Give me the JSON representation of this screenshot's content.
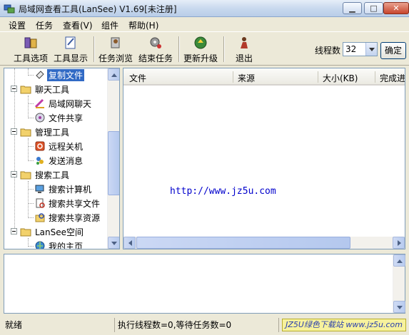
{
  "window": {
    "title": "局域网查看工具(LanSee) V1.69[未注册]"
  },
  "menu": [
    "设置",
    "任务",
    "查看(V)",
    "组件",
    "帮助(H)"
  ],
  "toolbar": {
    "buttons": [
      {
        "label": "工具选项",
        "icon": "options-icon"
      },
      {
        "label": "工具显示",
        "icon": "tool-display-icon"
      },
      {
        "label": "任务浏览",
        "icon": "task-browse-icon"
      },
      {
        "label": "结束任务",
        "icon": "end-task-icon"
      },
      {
        "label": "更新升级",
        "icon": "update-icon"
      },
      {
        "label": "退出",
        "icon": "exit-icon"
      }
    ],
    "thread_label": "线程数",
    "thread_value": "32",
    "ok_label": "确定"
  },
  "tree": [
    {
      "label": "复制文件",
      "icon": "copy-file-icon",
      "selected": true
    },
    {
      "label": "聊天工具",
      "icon": "folder-icon",
      "group": true
    },
    {
      "label": "局域网聊天",
      "icon": "chat-icon"
    },
    {
      "label": "文件共享",
      "icon": "share-icon"
    },
    {
      "label": "管理工具",
      "icon": "folder-icon",
      "group": true
    },
    {
      "label": "远程关机",
      "icon": "shutdown-icon"
    },
    {
      "label": "发送消息",
      "icon": "message-icon"
    },
    {
      "label": "搜索工具",
      "icon": "folder-icon",
      "group": true
    },
    {
      "label": "搜索计算机",
      "icon": "computer-search-icon"
    },
    {
      "label": "搜索共享文件",
      "icon": "file-search-icon"
    },
    {
      "label": "搜索共享资源",
      "icon": "resource-search-icon"
    },
    {
      "label": "LanSee空间",
      "icon": "folder-icon",
      "group": true
    },
    {
      "label": "我的主页",
      "icon": "homepage-icon"
    }
  ],
  "list": {
    "columns": [
      "文件",
      "来源",
      "大小(KB)",
      "完成进"
    ],
    "watermark_url": "http://www.jz5u.com"
  },
  "status": {
    "state": "就绪",
    "threads": "执行线程数=0,等待任务数=0",
    "brand": "JZ5U绿色下载站 www.jz5u.com"
  }
}
